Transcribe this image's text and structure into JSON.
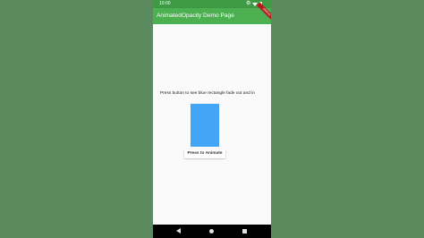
{
  "status_bar": {
    "time": "10:00",
    "settings_icon": "gear-icon",
    "wifi_icon": "wifi-icon",
    "battery_icon": "battery-icon"
  },
  "app_bar": {
    "title": "AnimatedOpacity Demo Page",
    "debug_banner": "DEBUG"
  },
  "content": {
    "instruction": "Press button to see blue rectangle fade out and in",
    "rectangle_color": "#42a5f5",
    "button_label": "Press to Animate"
  },
  "nav_bar": {
    "back_icon": "back-icon",
    "home_icon": "home-icon",
    "recents_icon": "recents-icon"
  },
  "colors": {
    "app_bar": "#4caf50",
    "status_bar": "#3f9a45",
    "backdrop": "#5b8a5f"
  }
}
